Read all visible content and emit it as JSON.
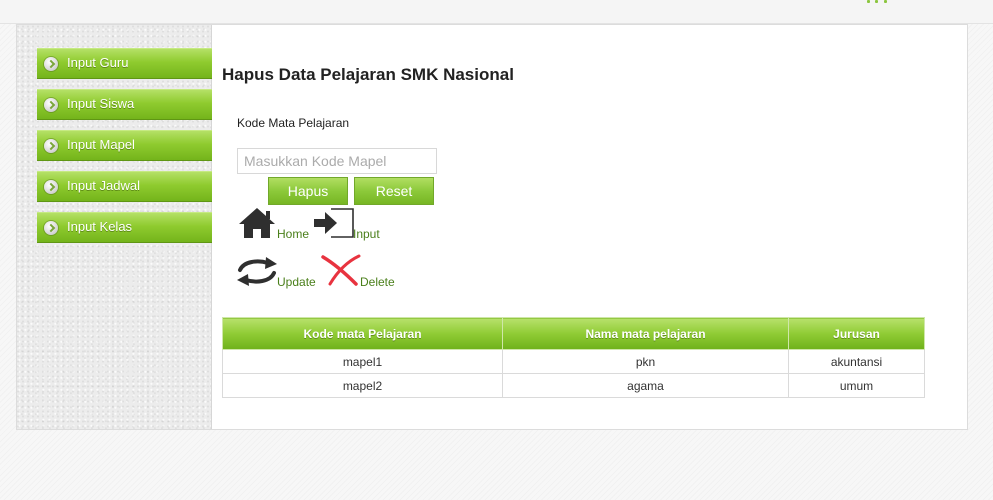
{
  "header": {},
  "sidebar": {
    "items": [
      {
        "label": "Input Guru"
      },
      {
        "label": "Input Siswa"
      },
      {
        "label": "Input Mapel"
      },
      {
        "label": "Input Jadwal"
      },
      {
        "label": "Input Kelas"
      }
    ]
  },
  "page": {
    "title": "Hapus Data Pelajaran SMK Nasional"
  },
  "form": {
    "label": "Kode Mata Pelajaran",
    "input_value": "",
    "input_placeholder": "Masukkan Kode Mapel",
    "hapus_label": "Hapus",
    "reset_label": "Reset"
  },
  "nav": {
    "home_label": "Home",
    "input_label": "Input",
    "update_label": "Update",
    "delete_label": "Delete"
  },
  "icons": {
    "home": "home-icon",
    "input": "sign-in-icon",
    "update": "exchange-arrows-icon",
    "delete": "red-x-icon"
  },
  "colors": {
    "accent_green": "#8cc63f",
    "link_green": "#4a7f1a",
    "delete_red": "#e8333f",
    "icon_dark": "#2f2f2f"
  },
  "table": {
    "headers": [
      "Kode mata Pelajaran",
      "Nama mata pelajaran",
      "Jurusan"
    ],
    "rows": [
      [
        "mapel1",
        "pkn",
        "akuntansi"
      ],
      [
        "mapel2",
        "agama",
        "umum"
      ]
    ]
  }
}
